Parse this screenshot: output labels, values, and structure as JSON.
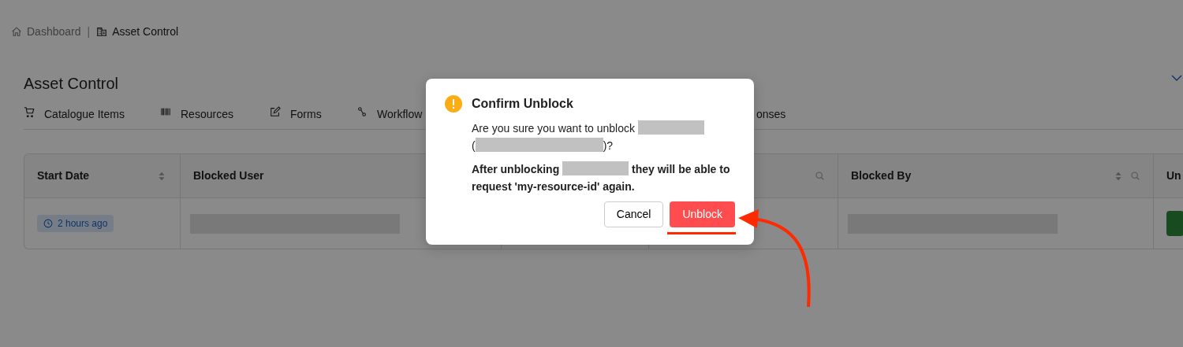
{
  "breadcrumb": [
    {
      "label": "Dashboard",
      "current": false
    },
    {
      "label": "Asset Control",
      "current": true
    }
  ],
  "breadcrumb_separator": "|",
  "page_title": "Asset Control",
  "tabs": [
    {
      "label": "Catalogue Items"
    },
    {
      "label": "Resources"
    },
    {
      "label": "Forms"
    },
    {
      "label": "Workflow"
    },
    {
      "label": "onses"
    }
  ],
  "table": {
    "columns": [
      {
        "label": "Start Date",
        "sortable": true,
        "filterable": false
      },
      {
        "label": "Blocked User"
      },
      {},
      {
        "sortable": false,
        "filterable": true
      },
      {
        "label": "Blocked By",
        "sortable": true,
        "filterable": true
      },
      {
        "label": "Un"
      }
    ],
    "rows": [
      {
        "cells": [
          {
            "kind": "time",
            "text": "2 hours ago"
          },
          {
            "kind": "redacted"
          },
          {
            "kind": "empty"
          },
          {
            "kind": "empty"
          },
          {
            "kind": "redacted"
          },
          {
            "kind": "action"
          }
        ]
      }
    ]
  },
  "dialog": {
    "title": "Confirm Unblock",
    "paragraphs": [
      {
        "bold": false,
        "parts": [
          {
            "kind": "text",
            "text": "Are you sure you want to unblock "
          },
          {
            "kind": "redacted"
          },
          {
            "kind": "text",
            "text": " ("
          },
          {
            "kind": "redacted"
          },
          {
            "kind": "text",
            "text": ")?"
          }
        ]
      },
      {
        "bold": true,
        "parts": [
          {
            "kind": "text",
            "text": "After unblocking "
          },
          {
            "kind": "redacted"
          },
          {
            "kind": "text",
            "text": " they will be able to request 'my-resource-id' again."
          }
        ]
      }
    ],
    "buttons": [
      {
        "label": "Cancel",
        "primary": false
      },
      {
        "label": "Unblock",
        "primary": true
      }
    ]
  },
  "annotations": {
    "underline": true,
    "arrow": true
  }
}
